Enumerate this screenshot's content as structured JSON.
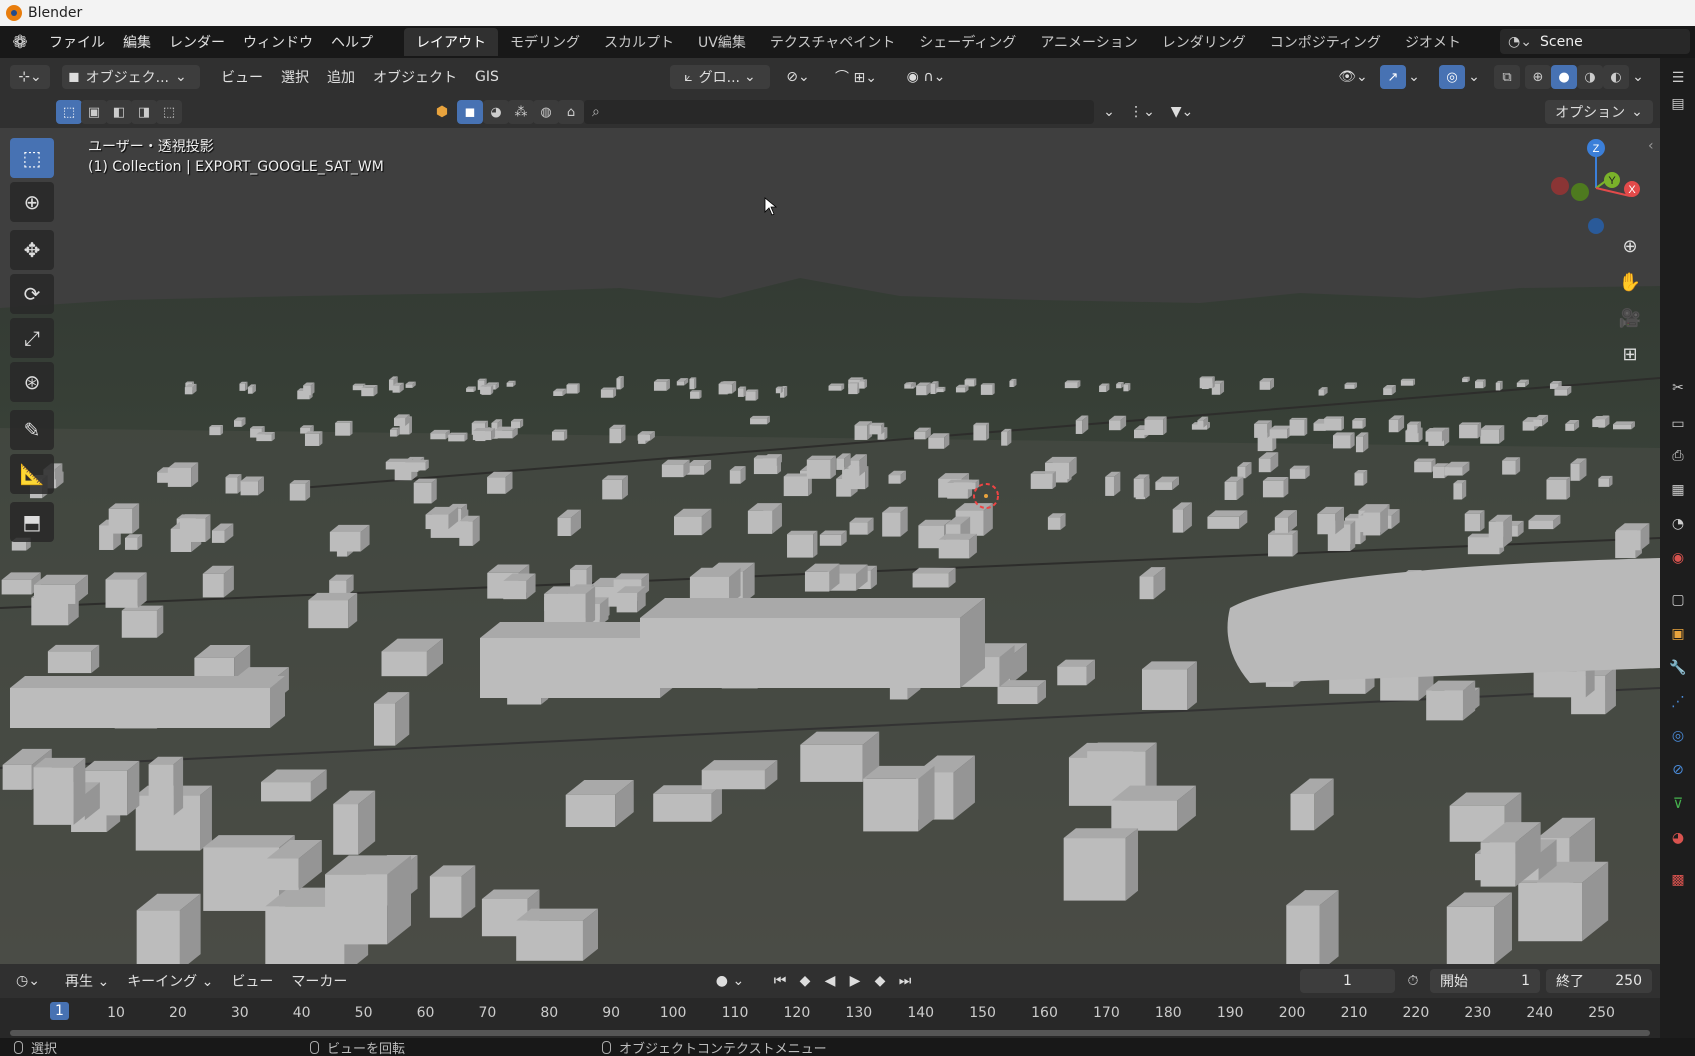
{
  "window": {
    "title": "Blender"
  },
  "menubar": {
    "items": [
      "ファイル",
      "編集",
      "レンダー",
      "ウィンドウ",
      "ヘルプ"
    ],
    "workspaces": [
      "レイアウト",
      "モデリング",
      "スカルプト",
      "UV編集",
      "テクスチャペイント",
      "シェーディング",
      "アニメーション",
      "レンダリング",
      "コンポジティング",
      "ジオメト"
    ],
    "active_workspace": "レイアウト",
    "scene_name": "Scene"
  },
  "header": {
    "mode_label": "オブジェク...",
    "menus": [
      "ビュー",
      "選択",
      "追加",
      "オブジェクト",
      "GIS"
    ],
    "transform_orientation": "グロ...",
    "options_label": "オプション"
  },
  "viewport": {
    "view_name": "ユーザー・透視投影",
    "collection_info": "(1) Collection | EXPORT_GOOGLE_SAT_WM",
    "gizmo_axes": [
      "Z",
      "Y",
      "X"
    ]
  },
  "tools": [
    "select-box",
    "cursor",
    "move",
    "rotate",
    "scale",
    "transform",
    "annotate",
    "measure",
    "add-cube"
  ],
  "timeline": {
    "menus": [
      "再生",
      "キーイング",
      "ビュー",
      "マーカー"
    ],
    "current_frame": "1",
    "start_label": "開始",
    "start_value": "1",
    "end_label": "終了",
    "end_value": "250",
    "ruler_ticks": [
      "1",
      "10",
      "20",
      "30",
      "40",
      "50",
      "60",
      "70",
      "80",
      "90",
      "100",
      "110",
      "120",
      "130",
      "140",
      "150",
      "160",
      "170",
      "180",
      "190",
      "200",
      "210",
      "220",
      "230",
      "240",
      "250"
    ]
  },
  "statusbar": {
    "select": "選択",
    "rotate_view": "ビューを回転",
    "context_menu": "オブジェクトコンテクストメニュー"
  },
  "colors": {
    "accent": "#4772b3",
    "header_bg": "#303030",
    "building": "#bdbdbd",
    "terrain": "#3d4a3e"
  }
}
